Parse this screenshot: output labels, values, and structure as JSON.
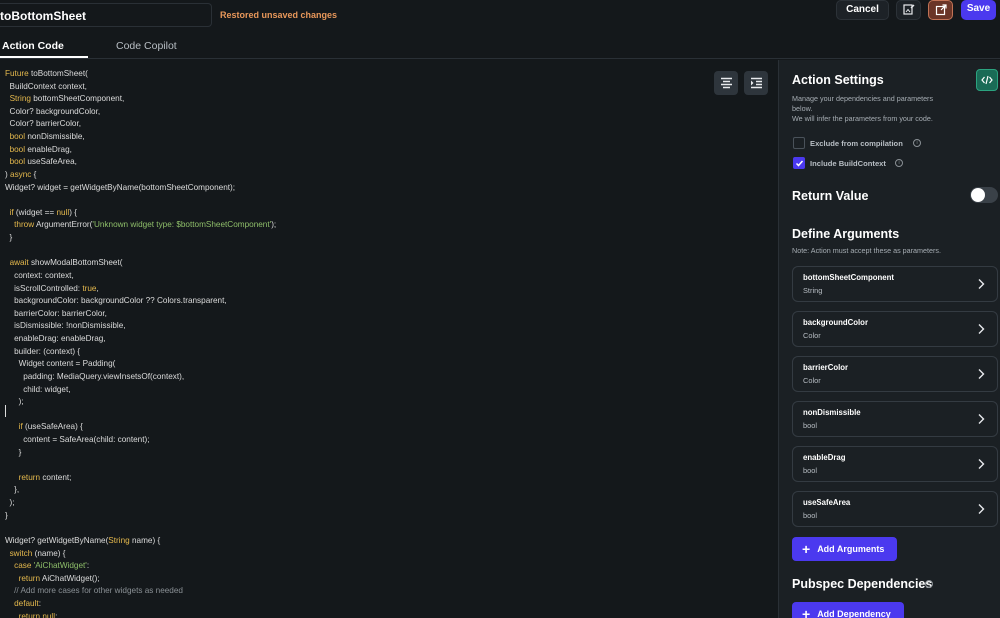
{
  "header": {
    "action_name": "toBottomSheet",
    "status": "Restored unsaved changes",
    "cancel_label": "Cancel",
    "save_label": "Save"
  },
  "tabs": [
    {
      "label": "Action Code",
      "active": true
    },
    {
      "label": "Code Copilot",
      "active": false
    }
  ],
  "code_lines": [
    "Future toBottomSheet(",
    "  BuildContext context,",
    "  String bottomSheetComponent,",
    "  Color? backgroundColor,",
    "  Color? barrierColor,",
    "  bool nonDismissible,",
    "  bool enableDrag,",
    "  bool useSafeArea,",
    ") async {",
    "Widget? widget = getWidgetByName(bottomSheetComponent);",
    "",
    "  if (widget == null) {",
    "    throw ArgumentError('Unknown widget type: $bottomSheetComponent');",
    "  }",
    "",
    "  await showModalBottomSheet(",
    "    context: context,",
    "    isScrollControlled: true,",
    "    backgroundColor: backgroundColor ?? Colors.transparent,",
    "    barrierColor: barrierColor,",
    "    isDismissible: !nonDismissible,",
    "    enableDrag: enableDrag,",
    "    builder: (context) {",
    "      Widget content = Padding(",
    "        padding: MediaQuery.viewInsetsOf(context),",
    "        child: widget,",
    "      );",
    "",
    "      if (useSafeArea) {",
    "        content = SafeArea(child: content);",
    "      }",
    "",
    "      return content;",
    "    },",
    "  );",
    "}",
    "",
    "Widget? getWidgetByName(String name) {",
    "  switch (name) {",
    "    case 'AiChatWidget':",
    "      return AiChatWidget();",
    "    // Add more cases for other widgets as needed",
    "    default:",
    "      return null;"
  ],
  "settings": {
    "title": "Action Settings",
    "desc_line1": "Manage your dependencies and parameters",
    "desc_line2": "below.",
    "desc_line3": "We will infer the parameters from your code.",
    "exclude_label": "Exclude from compilation",
    "exclude_checked": false,
    "include_label": "Include BuildContext",
    "include_checked": true,
    "return_value_label": "Return Value",
    "return_value_on": false,
    "define_args_title": "Define Arguments",
    "define_args_note": "Note: Action must accept these as parameters.",
    "arguments": [
      {
        "name": "bottomSheetComponent",
        "type": "String"
      },
      {
        "name": "backgroundColor",
        "type": "Color"
      },
      {
        "name": "barrierColor",
        "type": "Color"
      },
      {
        "name": "nonDismissible",
        "type": "bool"
      },
      {
        "name": "enableDrag",
        "type": "bool"
      },
      {
        "name": "useSafeArea",
        "type": "bool"
      }
    ],
    "add_arguments_label": "Add Arguments",
    "pubspec_title": "Pubspec Dependencies",
    "add_dependency_label": "Add Dependency"
  },
  "colors": {
    "accent": "#4b39ef",
    "keyword": "#e5b94d",
    "string": "#8fbf6a",
    "warning": "#e8975a"
  },
  "icons": [
    "edit-image-icon",
    "open-external-icon",
    "format-code-icon",
    "indent-icon",
    "code-view-icon",
    "info-icon",
    "chevron-right-icon",
    "plus-icon",
    "checkmark-icon"
  ]
}
